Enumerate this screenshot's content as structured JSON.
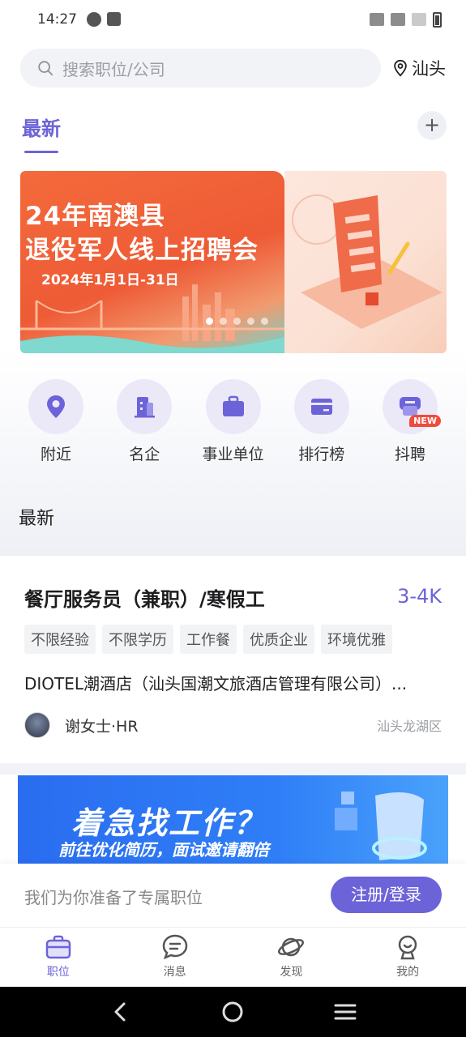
{
  "status_bar": {
    "time": "14:27"
  },
  "search": {
    "placeholder": "搜索职位/公司",
    "city": "汕头"
  },
  "tabs": {
    "latest": "最新",
    "add": "+"
  },
  "banner": {
    "line1": "24年南澳县",
    "line2": "退役军人线上招聘会",
    "date": "2024年1月1日-31日",
    "slide_count": 5,
    "active_slide": 1
  },
  "quick_entries": [
    {
      "label": "附近",
      "icon": "location-pin-icon"
    },
    {
      "label": "名企",
      "icon": "building-icon"
    },
    {
      "label": "事业单位",
      "icon": "briefcase-icon"
    },
    {
      "label": "排行榜",
      "icon": "card-icon"
    },
    {
      "label": "抖聘",
      "icon": "douyin-job-icon",
      "badge": "NEW"
    }
  ],
  "section_title": "最新",
  "job": {
    "title": "餐厅服务员（兼职）/寒假工",
    "salary": "3-4K",
    "tags": [
      "不限经验",
      "不限学历",
      "工作餐",
      "优质企业",
      "环境优雅"
    ],
    "company": "DIOTEL潮酒店（汕头国潮文旅酒店管理有限公司）...",
    "hr": "谢女士·HR",
    "area": "汕头龙湖区"
  },
  "ad": {
    "line1": "着急找工作？",
    "line2": "前往优化简历，面试邀请翻倍"
  },
  "register": {
    "text": "我们为你准备了专属职位",
    "button": "注册/登录"
  },
  "bottom_nav": [
    {
      "label": "职位",
      "icon": "briefcase-icon",
      "active": true
    },
    {
      "label": "消息",
      "icon": "chat-bubble-icon"
    },
    {
      "label": "发现",
      "icon": "planet-icon"
    },
    {
      "label": "我的",
      "icon": "profile-icon"
    }
  ],
  "colors": {
    "accent": "#6c63d9",
    "badge": "#ef4c3c"
  }
}
